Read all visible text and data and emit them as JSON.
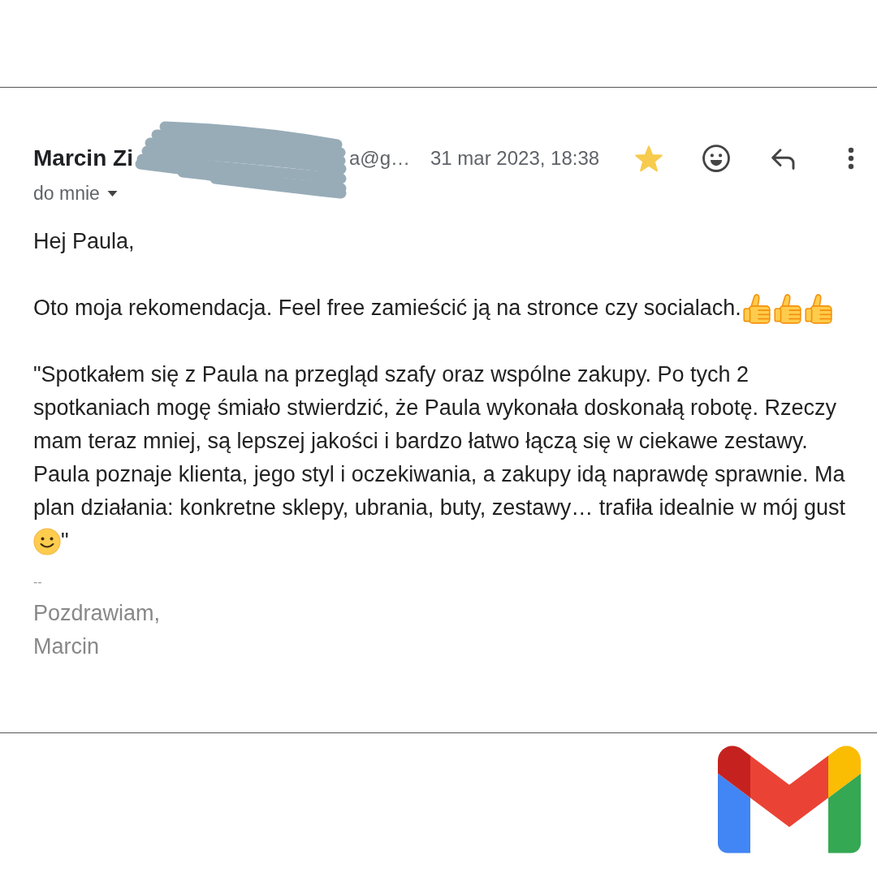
{
  "message": {
    "sender": {
      "name": "Marcin Zi",
      "email": "a@g…"
    },
    "date": "31 mar 2023, 18:38",
    "starred": true,
    "recipient": "do mnie"
  },
  "body": {
    "greeting": "Hej Paula,",
    "intro": "Oto moja rekomendacja. Feel free zamieścić ją na stronce czy socialach.",
    "quote": "\"Spotkałem się z Paula na przegląd szafy oraz wspólne zakupy. Po tych 2 spotkaniach mogę śmiało stwierdzić, że Paula wykonała doskonałą robotę. Rzeczy mam teraz mniej, są lepszej jakości i bardzo łatwo łączą się w ciekawe zestawy. Paula poznaje klienta, jego styl i oczekiwania, a zakupy idą naprawdę sprawnie. Ma plan działania: konkretne sklepy, ubrania, buty, zestawy… trafiła idealnie w mój gust",
    "quote_end": "\"",
    "signature_separator": "--",
    "signature": [
      "Pozdrawiam,",
      "Marcin"
    ]
  }
}
